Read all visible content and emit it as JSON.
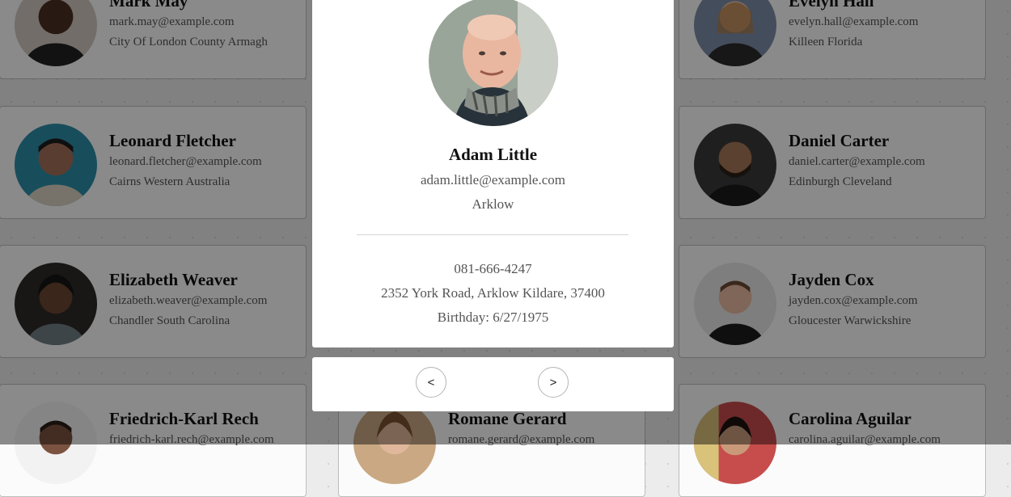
{
  "grid": [
    {
      "name": "Mark May",
      "email": "mark.may@example.com",
      "location": "City Of London County Armagh",
      "skin": "#4a2e22",
      "bg": "#cfc6bd"
    },
    {
      "name": "Evelyn Hall",
      "email": "evelyn.hall@example.com",
      "location": "Killeen Florida",
      "skin": "#e6c1a5",
      "bg": "#7d8da6"
    },
    {
      "name": "Leonard Fletcher",
      "email": "leonard.fletcher@example.com",
      "location": "Cairns Western Australia",
      "skin": "#a4705a",
      "bg": "#2c8da8"
    },
    {
      "name": "Daniel Carter",
      "email": "daniel.carter@example.com",
      "location": "Edinburgh Cleveland",
      "skin": "#a77757",
      "bg": "#3a3a3a"
    },
    {
      "name": "Elizabeth Weaver",
      "email": "elizabeth.weaver@example.com",
      "location": "Chandler South Carolina",
      "skin": "#6b4531",
      "bg": "#2f2a27"
    },
    {
      "name": "Jayden Cox",
      "email": "jayden.cox@example.com",
      "location": "Gloucester Warwickshire",
      "skin": "#e8bba2",
      "bg": "#e6e6e6"
    },
    {
      "name": "Friedrich-Karl Rech",
      "email": "friedrich-karl.rech@example.com",
      "location": "",
      "skin": "#7b5340",
      "bg": "#f2f2f2"
    },
    {
      "name": "Romane Gerard",
      "email": "romane.gerard@example.com",
      "location": "",
      "skin": "#e0b79a",
      "bg": "#c9a883"
    },
    {
      "name": "Carolina Aguilar",
      "email": "carolina.aguilar@example.com",
      "location": "",
      "skin": "#c9997a",
      "bg": "#c74c4c"
    }
  ],
  "modal": {
    "name": "Adam Little",
    "email": "adam.little@example.com",
    "city": "Arklow",
    "phone": "081-666-4247",
    "address": "2352 York Road, Arklow Kildare, 37400",
    "birthday": "Birthday: 6/27/1975",
    "skin": "#e9b7a0",
    "bg": "#9aa59a"
  },
  "nav": {
    "prev_label": "<",
    "next_label": ">"
  }
}
